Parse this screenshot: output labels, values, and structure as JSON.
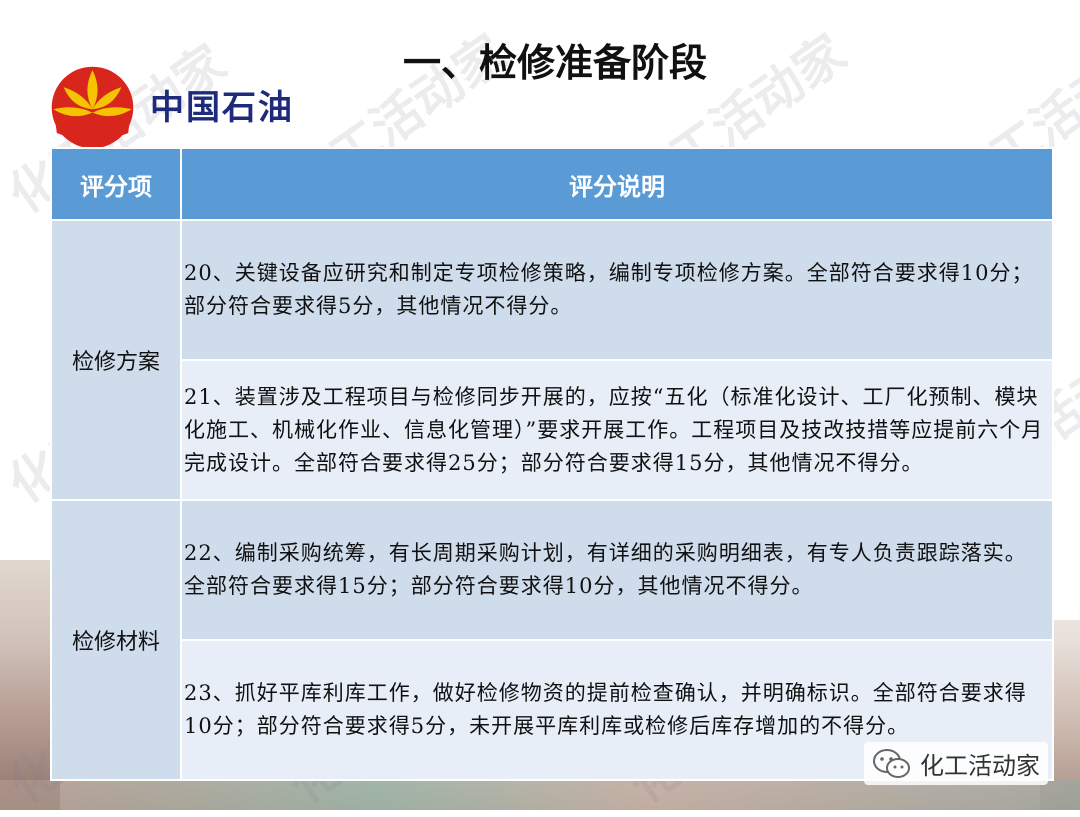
{
  "brand": {
    "logo_icon": "petrochina-logo-icon",
    "name": "中国石油"
  },
  "title": "一、检修准备阶段",
  "table": {
    "headers": [
      "评分项",
      "评分说明"
    ],
    "categories": [
      "检修方案",
      "检修材料"
    ],
    "rows": [
      "20、关键设备应研究和制定专项检修策略，编制专项检修方案。全部符合要求得10分；部分符合要求得5分，其他情况不得分。",
      "21、装置涉及工程项目与检修同步开展的，应按“五化（标准化设计、工厂化预制、模块化施工、机械化作业、信息化管理）”要求开展工作。工程项目及技改技措等应提前六个月完成设计。全部符合要求得25分；部分符合要求得15分，其他情况不得分。",
      "22、编制采购统筹，有长周期采购计划，有详细的采购明细表，有专人负责跟踪落实。全部符合要求得15分；部分符合要求得10分，其他情况不得分。",
      "23、抓好平库利库工作，做好检修物资的提前检查确认，并明确标识。全部符合要求得10分；部分符合要求得5分，未开展平库利库或检修后库存增加的不得分。"
    ]
  },
  "watermark": "化工活动家",
  "footer": {
    "icon": "wechat-icon",
    "text": "化工活动家"
  },
  "colors": {
    "header_bg": "#5b9bd5",
    "cell_dark": "#cfdcec",
    "cell_light": "#e7eef7",
    "brand_text": "#1e2a7a"
  }
}
